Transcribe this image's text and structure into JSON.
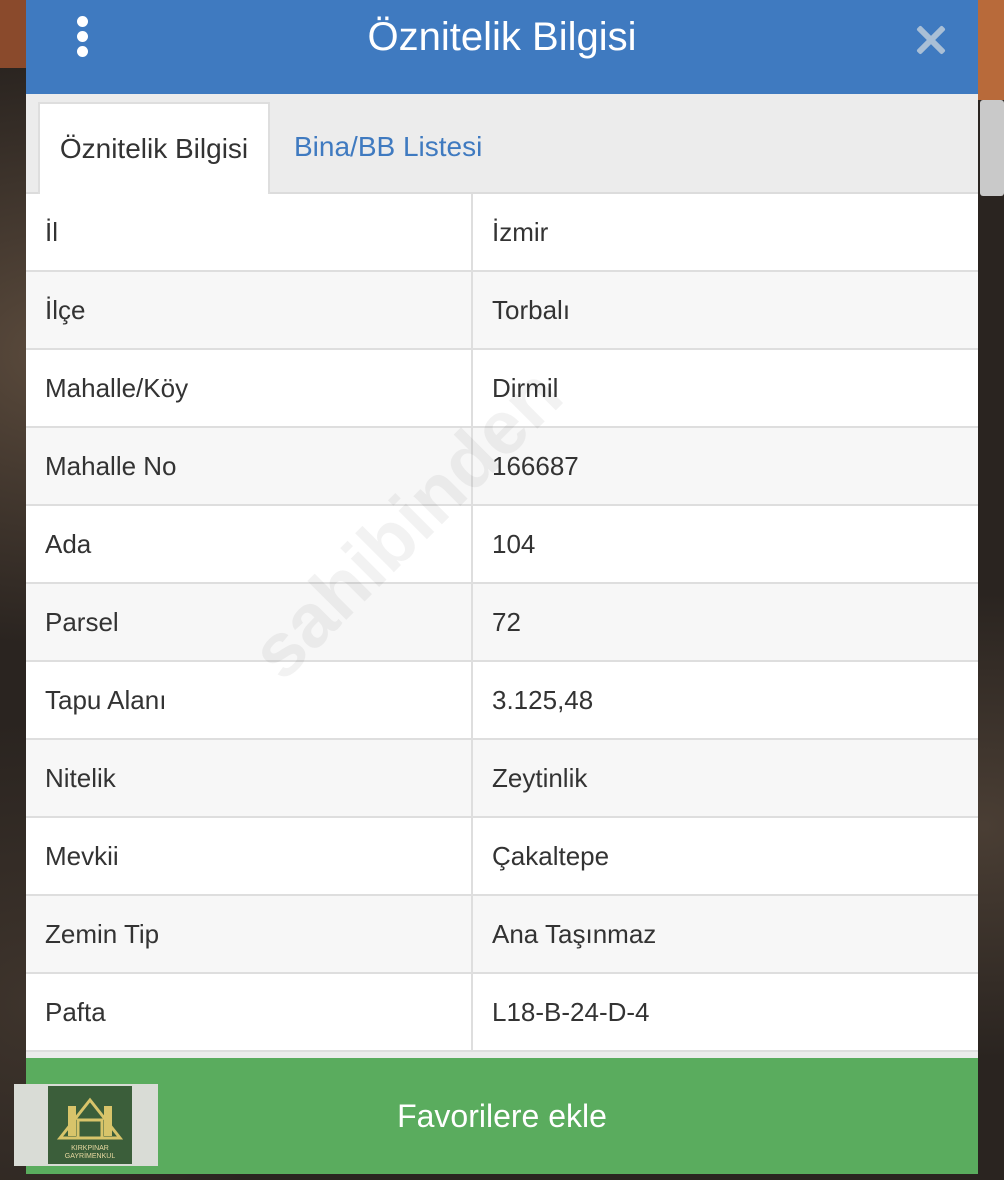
{
  "dialog": {
    "title": "Öznitelik Bilgisi",
    "menu_icon": "vertical-dots-icon",
    "close_icon": "close-icon"
  },
  "tabs": [
    {
      "label": "Öznitelik Bilgisi",
      "active": true
    },
    {
      "label": "Bina/BB Listesi",
      "active": false
    }
  ],
  "rows": [
    {
      "key": "İl",
      "value": "İzmir"
    },
    {
      "key": "İlçe",
      "value": "Torbalı"
    },
    {
      "key": "Mahalle/Köy",
      "value": "Dirmil"
    },
    {
      "key": "Mahalle No",
      "value": "166687"
    },
    {
      "key": "Ada",
      "value": "104"
    },
    {
      "key": "Parsel",
      "value": "72"
    },
    {
      "key": "Tapu Alanı",
      "value": "3.125,48"
    },
    {
      "key": "Nitelik",
      "value": "Zeytinlik"
    },
    {
      "key": "Mevkii",
      "value": "Çakaltepe"
    },
    {
      "key": "Zemin Tip",
      "value": "Ana Taşınmaz"
    },
    {
      "key": "Pafta",
      "value": "L18-B-24-D-4"
    }
  ],
  "favorites_button": {
    "label": "Favorilere ekle"
  },
  "watermark": {
    "text": "sahibinden"
  },
  "logo": {
    "line1": "KIRKPINAR",
    "line2": "GAYRİMENKUL"
  },
  "colors": {
    "header": "#3f7ac0",
    "tab_link": "#3f7ac0",
    "button": "#5aac5e"
  }
}
